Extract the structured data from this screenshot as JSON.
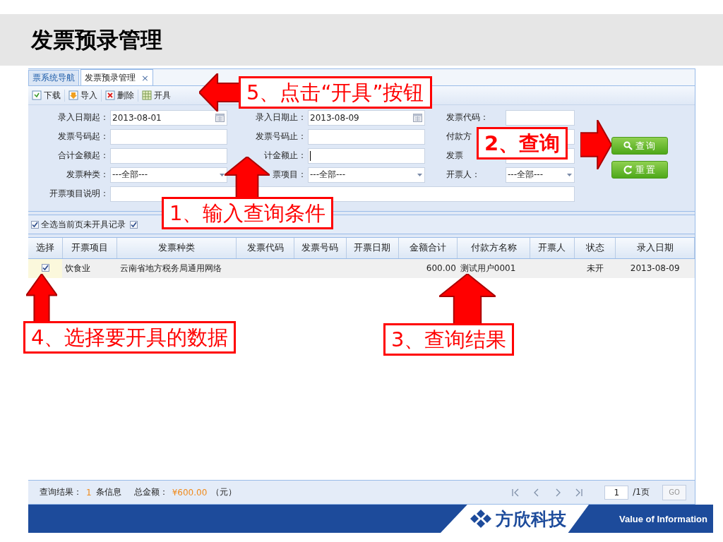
{
  "slide_title": "发票预录管理",
  "tabs": [
    {
      "label": "票系统导航",
      "selected": false
    },
    {
      "label": "发票预录管理",
      "selected": true,
      "close_mark": "×"
    }
  ],
  "toolbar": [
    {
      "label": "下载",
      "kind": "download"
    },
    {
      "label": "导入",
      "kind": "import"
    },
    {
      "label": "删除",
      "kind": "delete"
    },
    {
      "label": "开具",
      "kind": "issue"
    }
  ],
  "form": {
    "fields": [
      {
        "label": "录入日期起：",
        "kind": "date",
        "value": "2013-08-01"
      },
      {
        "label": "录入日期止：",
        "kind": "date",
        "value": "2013-08-09"
      },
      {
        "label": "发票代码：",
        "kind": "text"
      },
      {
        "label": "发票号码起：",
        "kind": "text"
      },
      {
        "label": "发票号码止：",
        "kind": "text"
      },
      {
        "label": "付款方",
        "kind": "text"
      },
      {
        "label": "合计金额起：",
        "kind": "text"
      },
      {
        "label": "计金额止：",
        "kind": "text",
        "focused": true
      },
      {
        "label": "发票",
        "kind": "text"
      },
      {
        "label": "发票种类：",
        "kind": "select",
        "value": "---全部---"
      },
      {
        "label": "票项目：",
        "kind": "select",
        "value": "---全部---"
      },
      {
        "label": "开票人：",
        "kind": "select",
        "value": "---全部---"
      },
      {
        "label": "开票项目说明：",
        "kind": "long_text"
      }
    ],
    "buttons": [
      {
        "label": "查询",
        "kind": "search"
      },
      {
        "label": "重置",
        "kind": "reset"
      }
    ]
  },
  "options_bar": [
    {
      "label": "全选当前页未开具记录",
      "checked": true
    },
    {
      "checked": true
    }
  ],
  "table": {
    "columns": [
      "选择",
      "开票项目",
      "发票种类",
      "发票代码",
      "发票号码",
      "开票日期",
      "金额合计",
      "付款方名称",
      "开票人",
      "状态",
      "录入日期"
    ],
    "rows": [
      {
        "checked": true,
        "cells": [
          "",
          "饮食业",
          "云南省地方税务局通用网络",
          "",
          "",
          "",
          "600.00",
          "测试用户0001",
          "",
          "未开",
          "2013-08-09"
        ]
      }
    ]
  },
  "footer": {
    "result_label": "查询结果：",
    "count": "1",
    "count_unit": "条信息",
    "total_label": "总金额：",
    "total": "¥600.00",
    "total_unit": "（元）",
    "page": "1",
    "page_total": "/1页",
    "go": "GO"
  },
  "brand": {
    "name": "方欣科技",
    "tagline": "Value of Information"
  },
  "callouts": [
    {
      "text": "5、点击“开具”按钮",
      "kind": "arrow_left"
    },
    {
      "text": "2、查询",
      "kind": "arrow_right"
    },
    {
      "text": "1、输入查询条件",
      "kind": "arrow_up"
    },
    {
      "text": "4、选择要开具的数据",
      "kind": "arrow_up"
    },
    {
      "text": "3、查询结果",
      "kind": "arrow_up"
    }
  ]
}
